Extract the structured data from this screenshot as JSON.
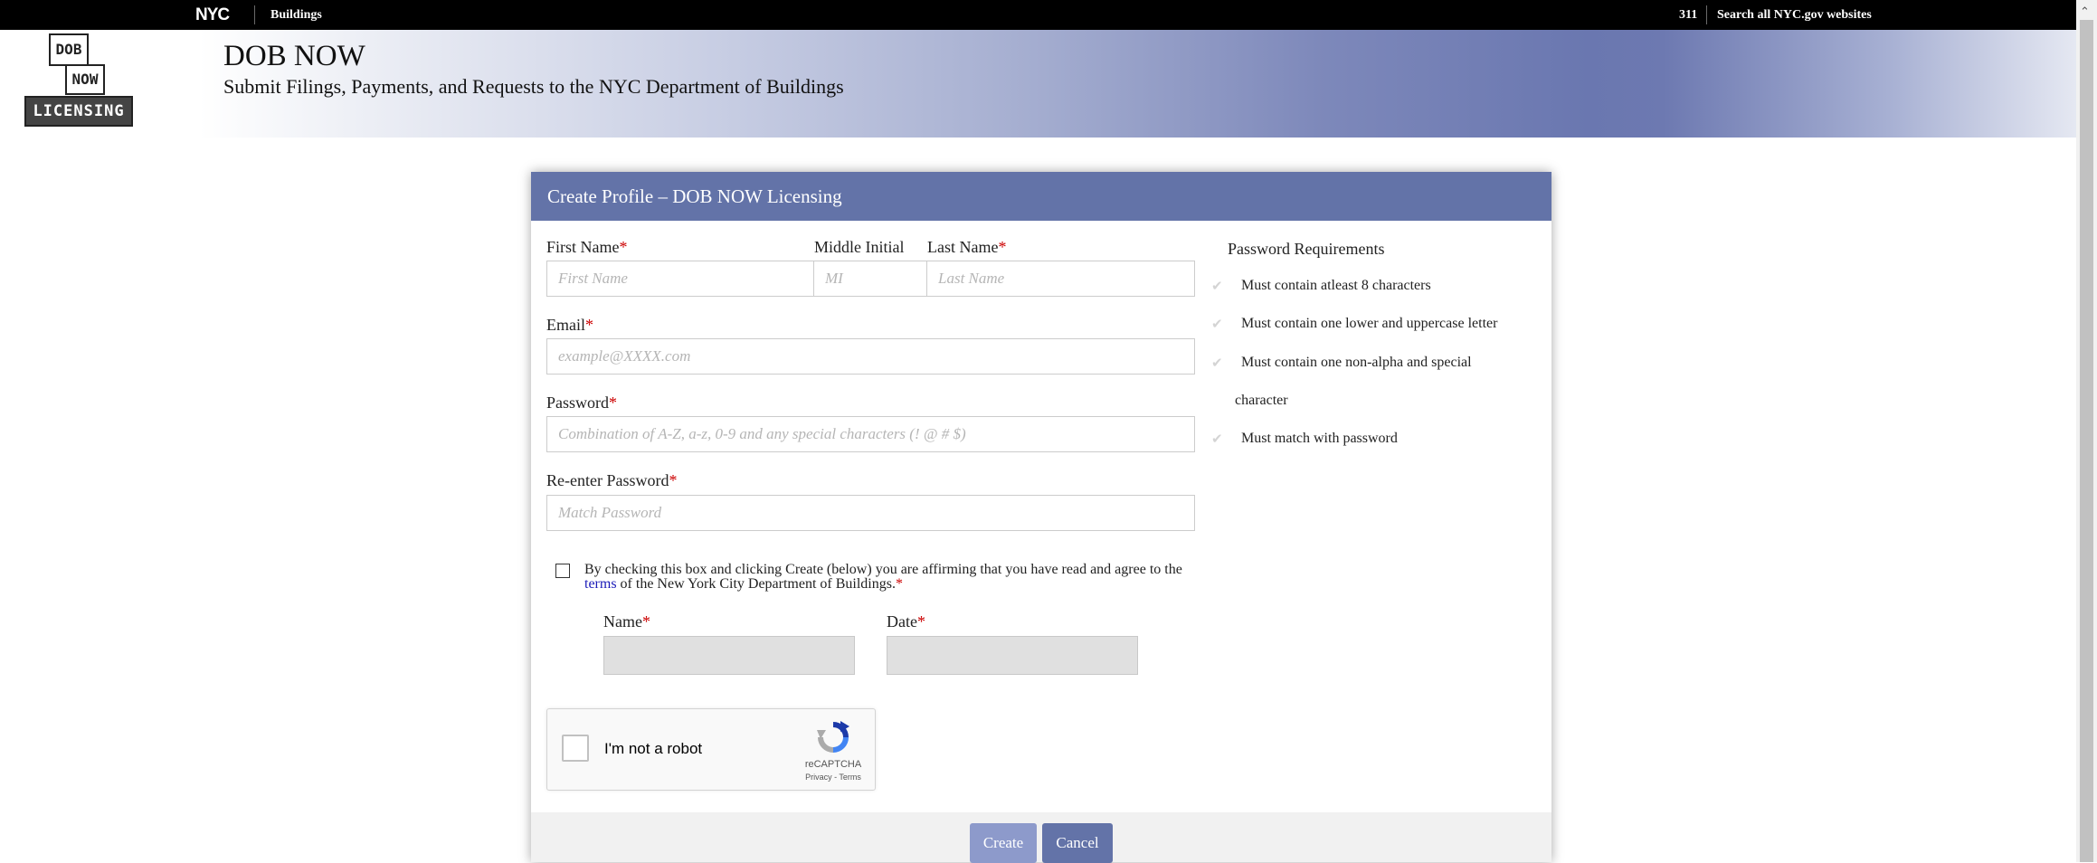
{
  "topbar": {
    "logo": "NYC",
    "agency_link": "Buildings",
    "phone_link": "311",
    "search_link": "Search all NYC.gov websites"
  },
  "header": {
    "logo_line1": "DOB",
    "logo_line2": "NOW",
    "logo_line3": "LICENSING",
    "title": "DOB NOW",
    "subtitle": "Submit Filings, Payments, and Requests to the NYC Department of Buildings"
  },
  "form": {
    "title": "Create Profile – DOB NOW Licensing",
    "required_mark": "*",
    "first_name": {
      "label": "First Name",
      "placeholder": "First Name",
      "value": ""
    },
    "middle_initial": {
      "label": "Middle Initial",
      "placeholder": "MI",
      "value": ""
    },
    "last_name": {
      "label": "Last Name",
      "placeholder": "Last Name",
      "value": ""
    },
    "email": {
      "label": "Email",
      "placeholder": "example@XXXX.com",
      "value": ""
    },
    "password": {
      "label": "Password",
      "placeholder": "Combination of A-Z, a-z, 0-9 and any special characters (! @ # $)",
      "value": ""
    },
    "reenter_password": {
      "label": "Re-enter Password",
      "placeholder": "Match Password",
      "value": ""
    },
    "agreement": {
      "text_before": "By checking this box and clicking Create (below) you are affirming that you have read and agree to the ",
      "link": "terms",
      "text_after": " of the New York City Department of Buildings.",
      "checked": false
    },
    "sign_name": {
      "label": "Name",
      "value": ""
    },
    "sign_date": {
      "label": "Date",
      "value": ""
    }
  },
  "password_requirements": {
    "title": "Password Requirements",
    "items": [
      "Must contain atleast 8 characters",
      "Must contain one lower and uppercase letter",
      "Must contain one non-alpha and special",
      "character",
      "Must match with password"
    ],
    "check_icon": "check-icon"
  },
  "captcha": {
    "label": "I'm not a robot",
    "brand": "reCAPTCHA",
    "links": "Privacy - Terms",
    "checked": false
  },
  "buttons": {
    "create": "Create",
    "cancel": "Cancel"
  },
  "colors": {
    "accent": "#6373a8",
    "create_button": "#8d9acb",
    "required": "#cc0000",
    "link": "#1a1ab8"
  }
}
